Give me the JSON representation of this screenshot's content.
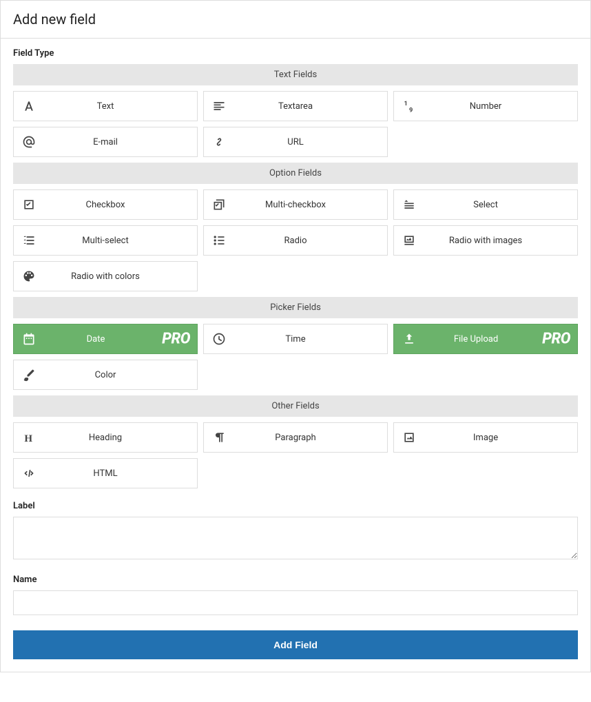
{
  "panel": {
    "title": "Add new field"
  },
  "field_type_label": "Field Type",
  "pro_badge": "PRO",
  "groups": [
    {
      "title": "Text Fields",
      "items": [
        {
          "label": "Text",
          "icon": "font",
          "pro": false,
          "name": "text"
        },
        {
          "label": "Textarea",
          "icon": "align-left",
          "pro": false,
          "name": "textarea"
        },
        {
          "label": "Number",
          "icon": "number",
          "pro": false,
          "name": "number"
        },
        {
          "label": "E-mail",
          "icon": "at",
          "pro": false,
          "name": "email"
        },
        {
          "label": "URL",
          "icon": "link",
          "pro": false,
          "name": "url"
        }
      ]
    },
    {
      "title": "Option Fields",
      "items": [
        {
          "label": "Checkbox",
          "icon": "checkbox",
          "pro": false,
          "name": "checkbox"
        },
        {
          "label": "Multi-checkbox",
          "icon": "multi-checkbox",
          "pro": false,
          "name": "multi-checkbox"
        },
        {
          "label": "Select",
          "icon": "select",
          "pro": false,
          "name": "select"
        },
        {
          "label": "Multi-select",
          "icon": "multi-select",
          "pro": false,
          "name": "multi-select"
        },
        {
          "label": "Radio",
          "icon": "radio",
          "pro": false,
          "name": "radio"
        },
        {
          "label": "Radio with images",
          "icon": "image-radio",
          "pro": false,
          "name": "radio-images"
        },
        {
          "label": "Radio with colors",
          "icon": "palette",
          "pro": false,
          "name": "radio-colors"
        }
      ]
    },
    {
      "title": "Picker Fields",
      "items": [
        {
          "label": "Date",
          "icon": "calendar",
          "pro": true,
          "name": "date"
        },
        {
          "label": "Time",
          "icon": "clock",
          "pro": false,
          "name": "time"
        },
        {
          "label": "File Upload",
          "icon": "upload",
          "pro": true,
          "name": "file-upload"
        },
        {
          "label": "Color",
          "icon": "brush",
          "pro": false,
          "name": "color"
        }
      ]
    },
    {
      "title": "Other Fields",
      "items": [
        {
          "label": "Heading",
          "icon": "heading",
          "pro": false,
          "name": "heading"
        },
        {
          "label": "Paragraph",
          "icon": "paragraph",
          "pro": false,
          "name": "paragraph"
        },
        {
          "label": "Image",
          "icon": "image",
          "pro": false,
          "name": "image"
        },
        {
          "label": "HTML",
          "icon": "code",
          "pro": false,
          "name": "html"
        }
      ]
    }
  ],
  "label_field": {
    "label": "Label",
    "value": ""
  },
  "name_field": {
    "label": "Name",
    "value": ""
  },
  "submit": {
    "label": "Add Field"
  }
}
